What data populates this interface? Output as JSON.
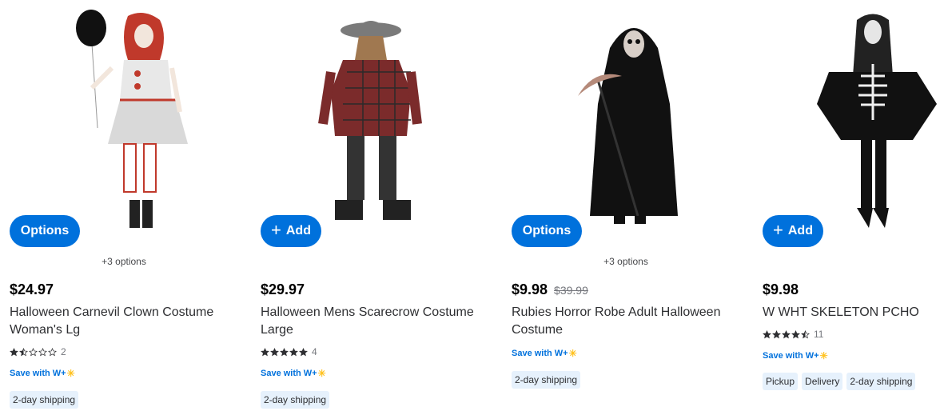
{
  "products": [
    {
      "button": {
        "type": "options",
        "label": "Options"
      },
      "more_options": "+3 options",
      "price": "$24.97",
      "was_price": "",
      "title": "Halloween Carnevil Clown Costume Woman's Lg",
      "rating": 1.5,
      "review_count": "2",
      "save_with": "Save with",
      "save_brand": "W+",
      "tags": [
        "2-day shipping"
      ],
      "image_icon": "clown-costume-image"
    },
    {
      "button": {
        "type": "add",
        "label": "Add",
        "icon": "+"
      },
      "more_options": "",
      "price": "$29.97",
      "was_price": "",
      "title": "Halloween Mens Scarecrow Costume Large",
      "rating": 5,
      "review_count": "4",
      "save_with": "Save with",
      "save_brand": "W+",
      "tags": [
        "2-day shipping"
      ],
      "image_icon": "scarecrow-costume-image"
    },
    {
      "button": {
        "type": "options",
        "label": "Options"
      },
      "more_options": "+3 options",
      "price": "$9.98",
      "was_price": "$39.99",
      "title": "Rubies Horror Robe Adult Halloween Costume",
      "rating": null,
      "review_count": "",
      "save_with": "Save with",
      "save_brand": "W+",
      "tags": [
        "2-day shipping"
      ],
      "image_icon": "grim-reaper-costume-image"
    },
    {
      "button": {
        "type": "add",
        "label": "Add",
        "icon": "+"
      },
      "more_options": "",
      "price": "$9.98",
      "was_price": "",
      "title": "W WHT SKELETON PCHO",
      "rating": 4.5,
      "review_count": "11",
      "save_with": "Save with",
      "save_brand": "W+",
      "tags": [
        "Pickup",
        "Delivery",
        "2-day shipping"
      ],
      "image_icon": "skeleton-poncho-costume-image"
    }
  ],
  "colors": {
    "accent": "#0071dc",
    "spark": "#ffc220",
    "tag_bg": "#e6f1fc"
  }
}
